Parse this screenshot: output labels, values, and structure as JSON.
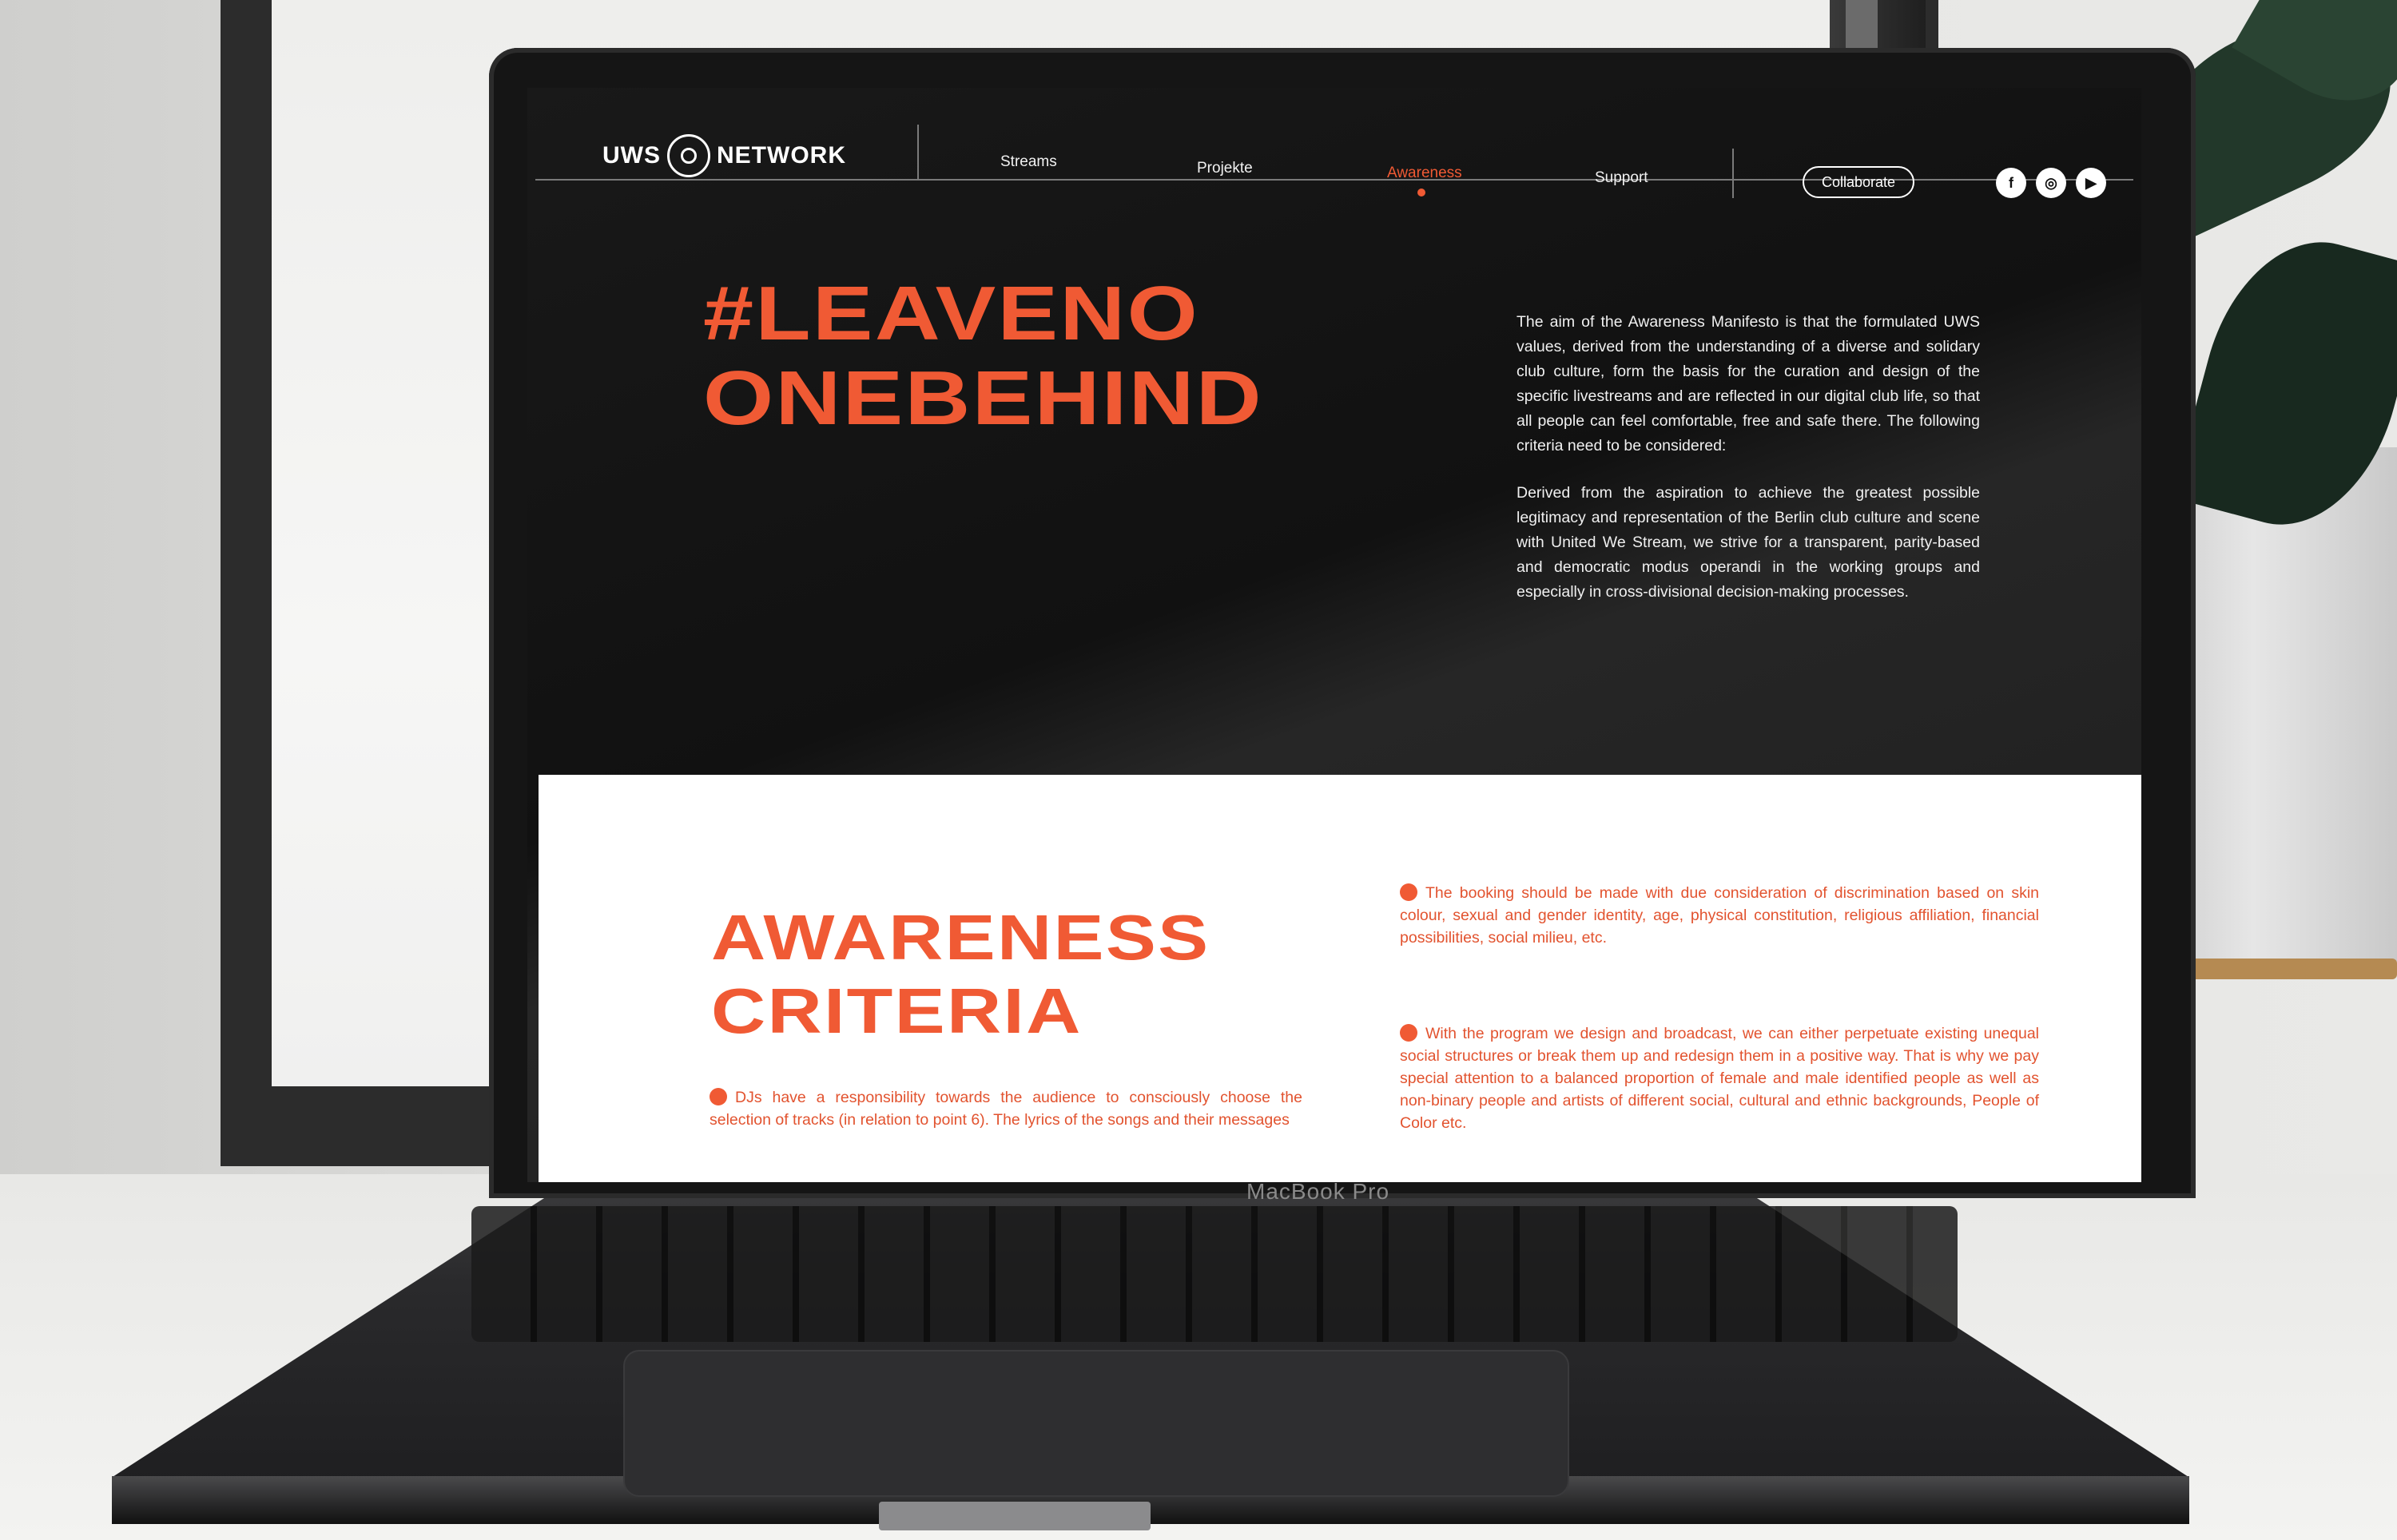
{
  "device": {
    "brand_label": "MacBook Pro"
  },
  "header": {
    "logo_left": "UWS",
    "logo_right": "NETWORK",
    "nav": [
      {
        "label": "Streams",
        "active": false
      },
      {
        "label": "Projekte",
        "active": false
      },
      {
        "label": "Awareness",
        "active": true
      },
      {
        "label": "Support",
        "active": false
      }
    ],
    "collaborate_label": "Collaborate",
    "social": [
      {
        "icon": "facebook-icon",
        "glyph": "f"
      },
      {
        "icon": "instagram-icon",
        "glyph": "◎"
      },
      {
        "icon": "youtube-icon",
        "glyph": "▶"
      }
    ]
  },
  "hero": {
    "title_line1": "#LEAVENO",
    "title_line2": "ONEBEHIND",
    "paragraph1": "The aim of the Awareness Manifesto is that the formulated UWS values, derived from the understanding of a diverse and solidary club culture, form the basis for the curation and design of the specific livestreams and are reflected in our digital club life, so that all people can feel comfortable, free and safe there. The following criteria need to be considered:",
    "paragraph2": "Derived from the aspiration to achieve the greatest possible legitimacy and representation of the Berlin club culture and scene with United We Stream, we strive for a transparent, parity-based and democratic modus operandi in the working groups and especially in cross-divisional decision-making processes."
  },
  "criteria": {
    "title_line1": "AWARENESS",
    "title_line2": "CRITERIA",
    "items": [
      "DJs have a responsibility towards the audience to consciously choose the selection of tracks (in relation to point 6). The lyrics of the songs and their messages",
      "The booking should be made with due consideration of discrimination based on skin colour, sexual and gender identity, age, physical constitution, religious affiliation, financial possibilities, social milieu, etc.",
      "With the program we design and broadcast, we can either perpetuate existing unequal social structures or break them up and redesign them in a positive way. That is why we pay special attention to a balanced proportion of female and male identified people as well as non-binary people and artists of different social, cultural and ethnic backgrounds, People of Color etc."
    ]
  },
  "colors": {
    "accent": "#f05a34",
    "screen_bg": "#141414",
    "section_bg": "#ffffff"
  }
}
